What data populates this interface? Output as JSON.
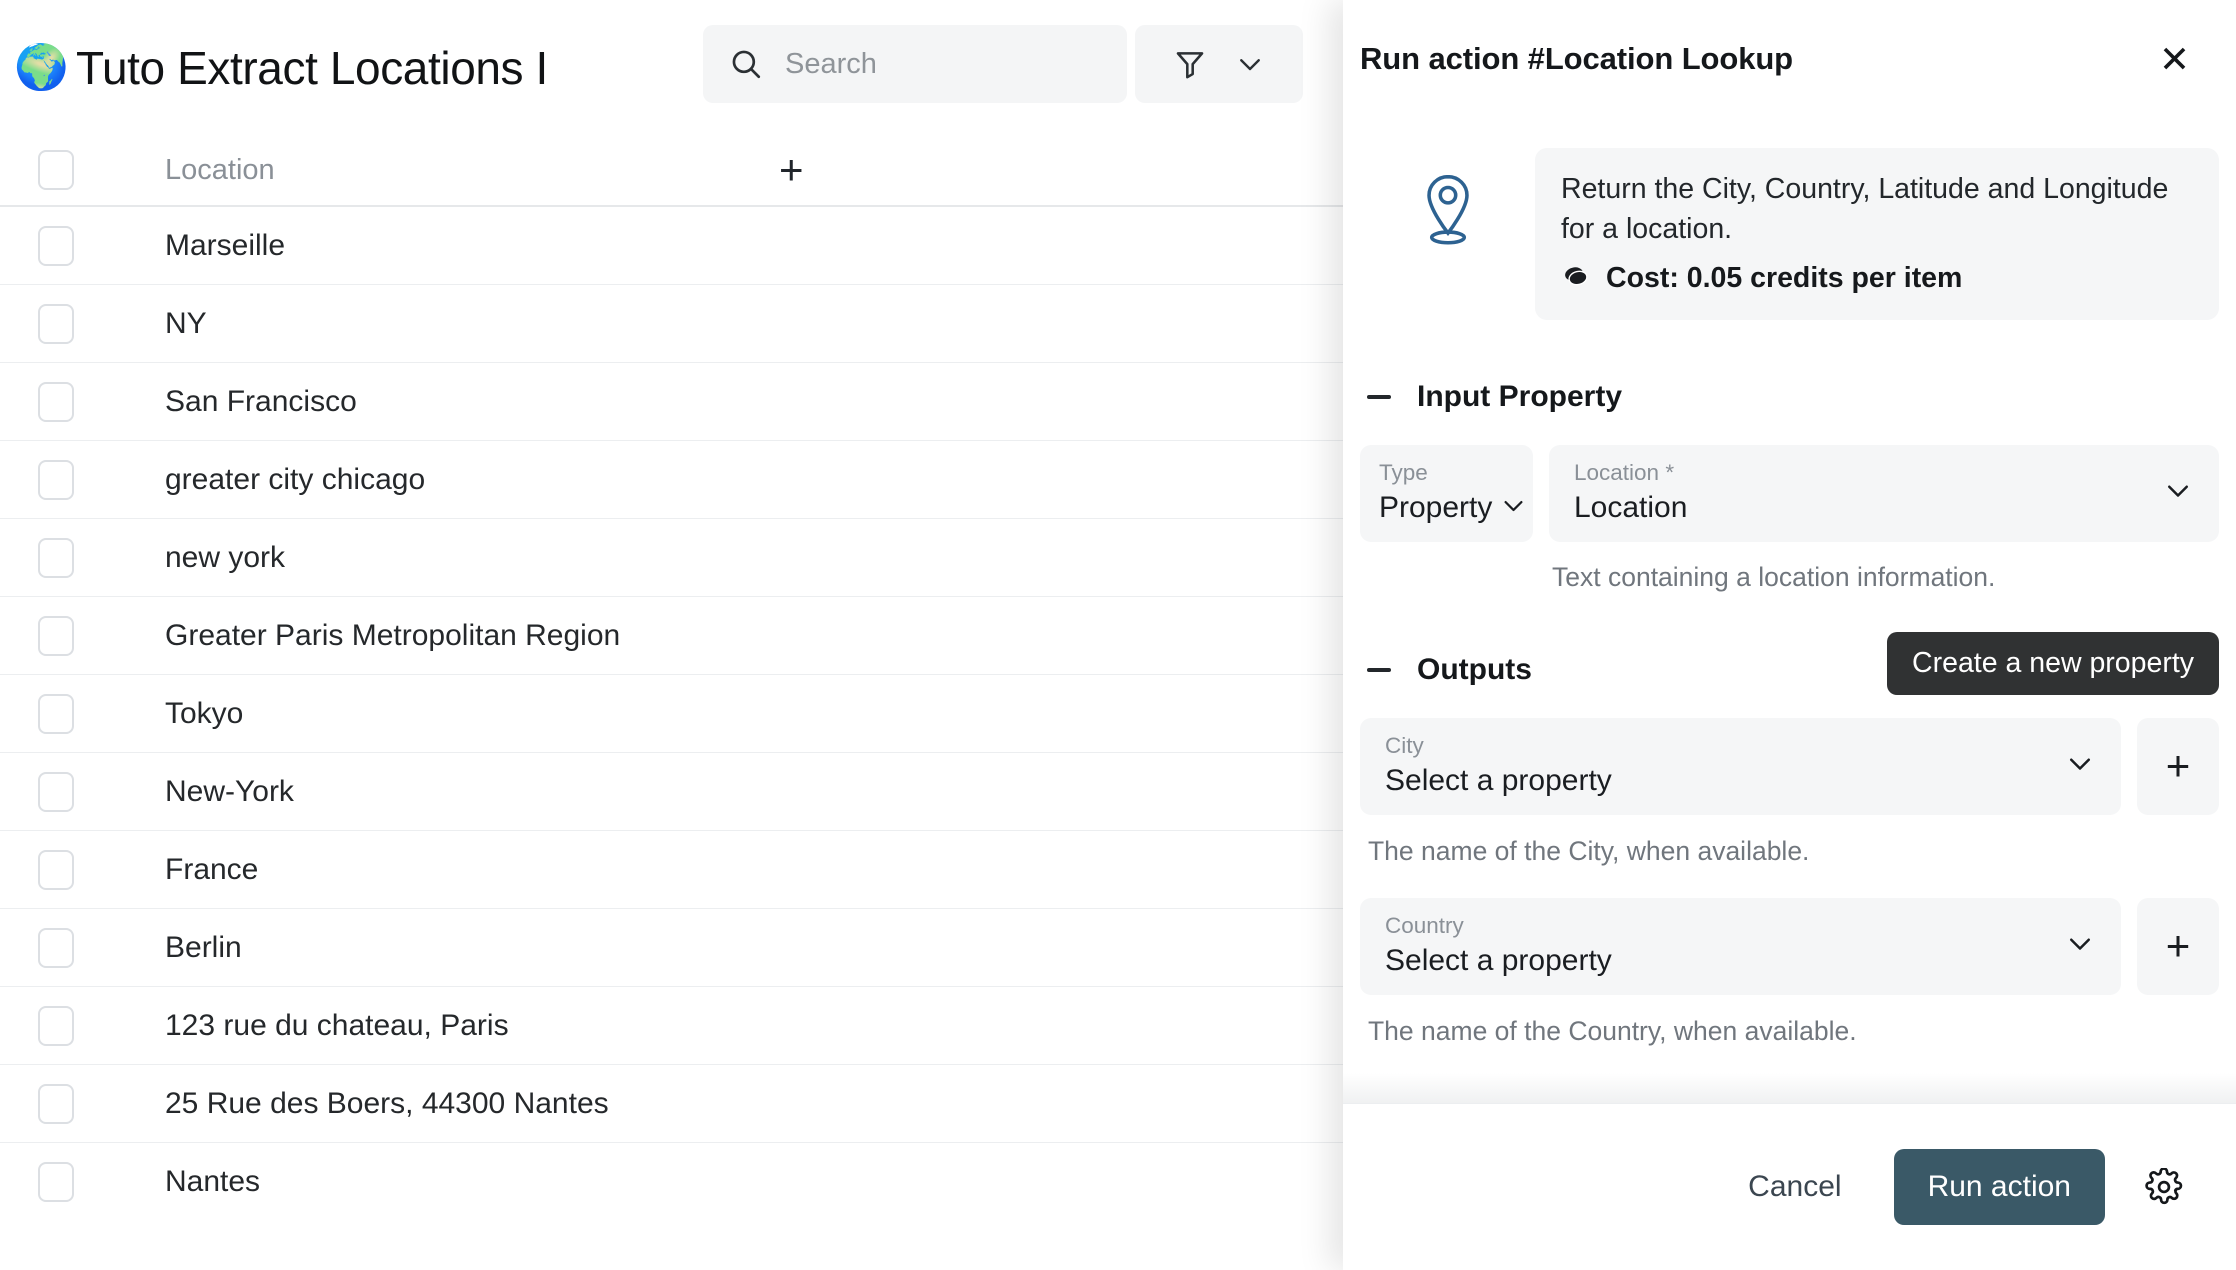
{
  "board": {
    "emoji": "🌍",
    "emoji_name": "globe-showing-europe-africa",
    "title": "Tuto Extract Locations I"
  },
  "toolbar": {
    "search_placeholder": "Search",
    "search_value": "",
    "search_icon": "search-icon",
    "filter_icon": "filter-icon",
    "chevron_icon": "chevron-down-icon"
  },
  "table": {
    "columns": [
      "Location"
    ],
    "add_column_label": "+",
    "select_all_checked": false,
    "rows": [
      {
        "location": "Marseille",
        "checked": false
      },
      {
        "location": "NY",
        "checked": false
      },
      {
        "location": "San Francisco",
        "checked": false
      },
      {
        "location": "greater city chicago",
        "checked": false
      },
      {
        "location": "new york",
        "checked": false
      },
      {
        "location": "Greater Paris Metropolitan Region",
        "checked": false
      },
      {
        "location": "Tokyo",
        "checked": false
      },
      {
        "location": "New-York",
        "checked": false
      },
      {
        "location": "France",
        "checked": false
      },
      {
        "location": "Berlin",
        "checked": false
      },
      {
        "location": "123 rue du chateau, Paris",
        "checked": false
      },
      {
        "location": "25 Rue des Boers, 44300 Nantes",
        "checked": false
      },
      {
        "location": "Nantes",
        "checked": false
      }
    ]
  },
  "panel": {
    "title": "Run action #Location Lookup",
    "close_label": "✕",
    "description": {
      "icon": "map-pin-icon",
      "text": "Return the City, Country, Latitude and Longitude for a location.",
      "cost_icon": "coins-icon",
      "cost_text": "Cost: 0.05 credits per item"
    },
    "input_section": {
      "title": "Input Property",
      "type_field": {
        "label": "Type",
        "value": "Property"
      },
      "location_field": {
        "label": "Location *",
        "value": "Location"
      },
      "help": "Text containing a location information."
    },
    "outputs_section": {
      "title": "Outputs",
      "tooltip": "Create a new property",
      "add_button_label": "+",
      "items": [
        {
          "label": "City",
          "value": "Select a property",
          "help": "The name of the City, when available."
        },
        {
          "label": "Country",
          "value": "Select a property",
          "help": "The name of the Country, when available."
        }
      ]
    },
    "footer": {
      "cancel_label": "Cancel",
      "run_label": "Run action",
      "settings_icon": "gear-icon"
    }
  },
  "colors": {
    "accent": "#3a5967",
    "pin_blue": "#2d6291",
    "tooltip_bg": "#303233",
    "field_bg": "#f5f6f7",
    "text": "#15181b",
    "muted": "#70767d"
  }
}
